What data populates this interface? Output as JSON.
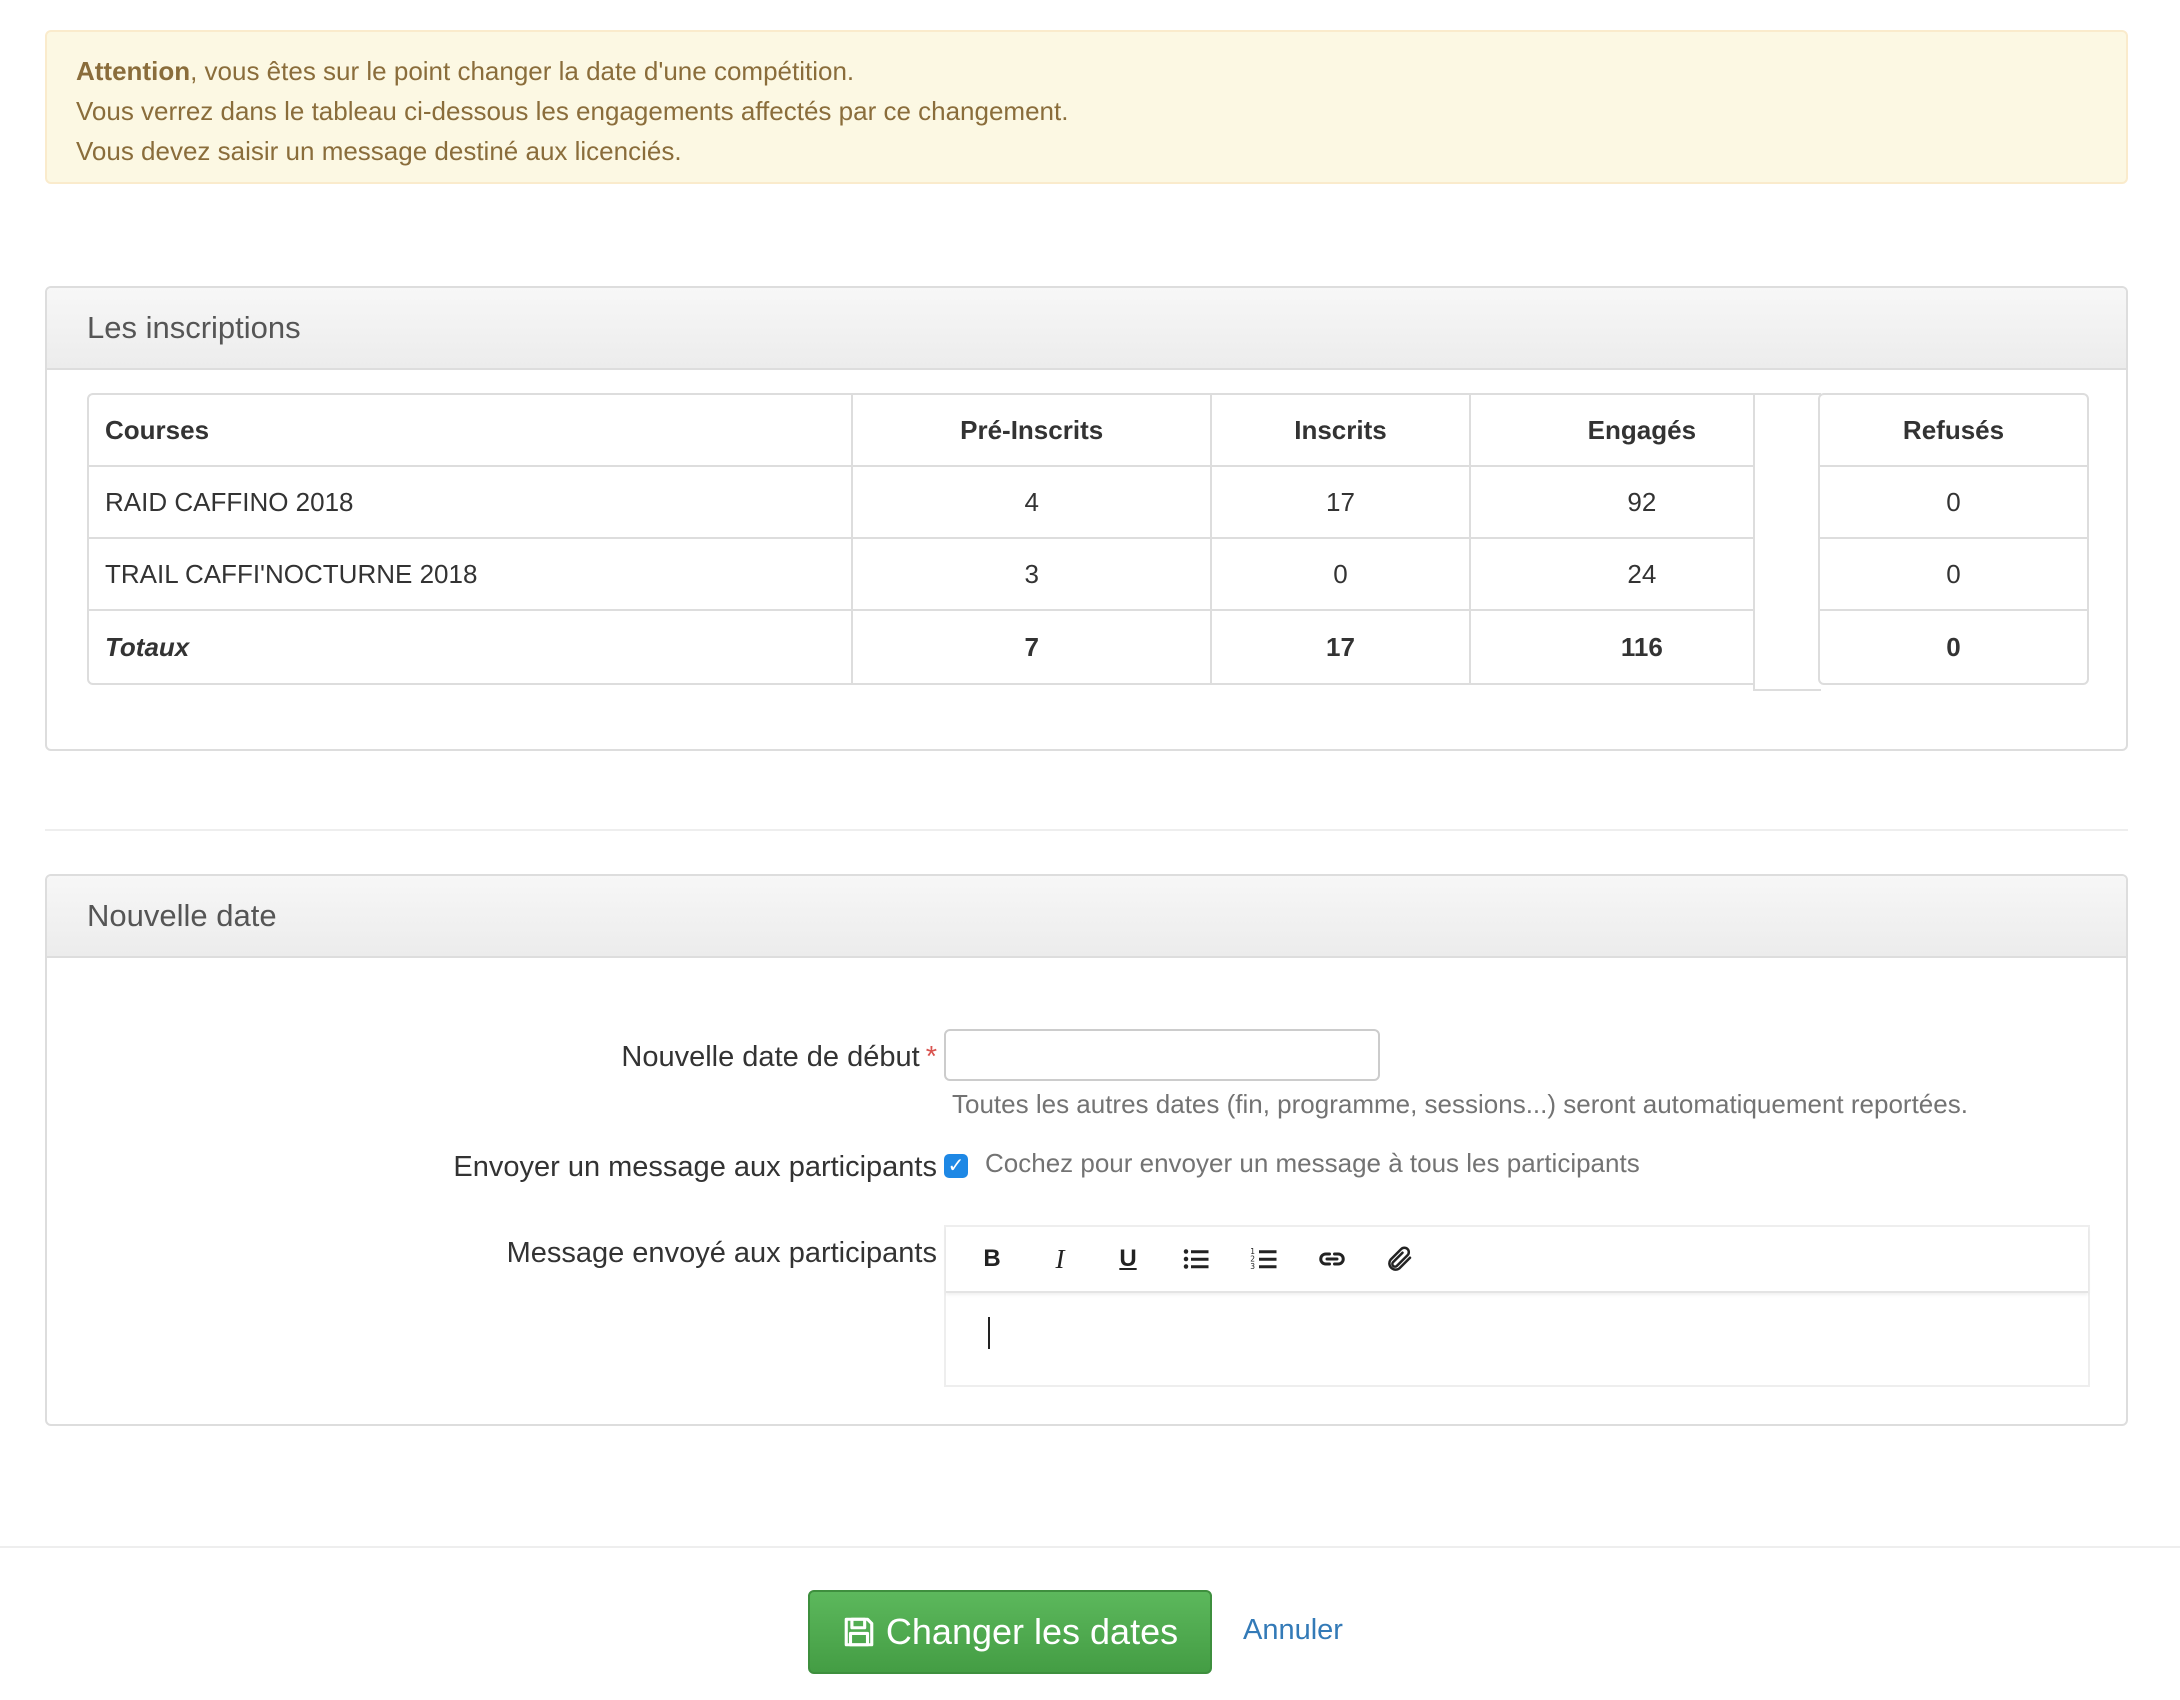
{
  "alert": {
    "strong": "Attention",
    "line1_rest": ", vous êtes sur le point changer la date d'une compétition.",
    "line2": "Vous verrez dans le tableau ci-dessous les engagements affectés par ce changement.",
    "line3": "Vous devez saisir un message destiné aux licenciés.",
    "colors": {
      "background": "#fcf8e3",
      "text": "#8a6d3b"
    }
  },
  "inscriptions": {
    "title": "Les inscriptions",
    "headers": {
      "courses": "Courses",
      "pre": "Pré-Inscrits",
      "inscrits": "Inscrits",
      "engages": "Engagés",
      "refuses": "Refusés"
    },
    "rows": [
      {
        "course": "RAID CAFFINO 2018",
        "pre": "4",
        "inscrits": "17",
        "engages": "92",
        "refuses": "0"
      },
      {
        "course": "TRAIL CAFFI'NOCTURNE 2018",
        "pre": "3",
        "inscrits": "0",
        "engages": "24",
        "refuses": "0"
      }
    ],
    "total": {
      "label": "Totaux",
      "pre": "7",
      "inscrits": "17",
      "engages": "116",
      "refuses": "0"
    }
  },
  "nouvelle_date": {
    "title": "Nouvelle date",
    "start_label": "Nouvelle date de début",
    "required_mark": "*",
    "start_value": "",
    "help": "Toutes les autres dates (fin, programme, sessions...) seront automatiquement reportées.",
    "send_label": "Envoyer un message aux participants",
    "send_checked": true,
    "send_checkbox_label": "Cochez pour envoyer un message à tous les participants",
    "message_label": "Message envoyé aux participants",
    "toolbar": {
      "bold": "B",
      "italic": "I",
      "underline": "U"
    },
    "message_value": ""
  },
  "footer": {
    "submit_label": "Changer les dates",
    "cancel_label": "Annuler",
    "colors": {
      "submit": "#5cb85c",
      "link": "#337ab7"
    }
  }
}
